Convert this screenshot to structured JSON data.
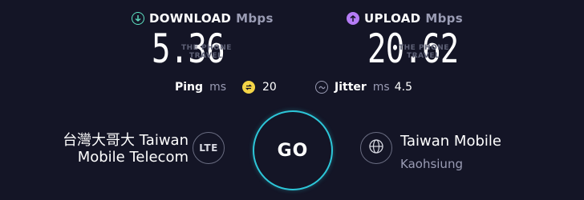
{
  "download": {
    "label": "DOWNLOAD",
    "unit": "Mbps",
    "value": "5.36",
    "icon": "download-arrow-icon",
    "icon_color": "#5ee3c3"
  },
  "upload": {
    "label": "UPLOAD",
    "unit": "Mbps",
    "value": "20.62",
    "icon": "upload-arrow-icon",
    "icon_color": "#b57cf5"
  },
  "watermark": {
    "line1": "THE PHONE",
    "line2": "TRAVEL"
  },
  "ping": {
    "label": "Ping",
    "unit": "ms",
    "value": "20",
    "icon": "ping-icon",
    "icon_color": "#f4d547"
  },
  "jitter": {
    "label": "Jitter",
    "unit": "ms",
    "value": "4.5",
    "icon": "jitter-icon"
  },
  "go_button": {
    "label": "GO",
    "ring_color": "#2dc6d8"
  },
  "isp": {
    "line1": "台灣大哥大 Taiwan",
    "line2": "Mobile Telecom",
    "badge": "LTE"
  },
  "server": {
    "name": "Taiwan Mobile",
    "location": "Kaohsiung",
    "icon": "globe-icon"
  }
}
